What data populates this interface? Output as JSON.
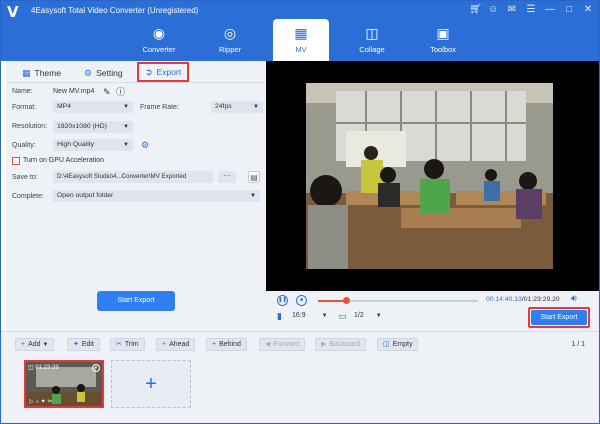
{
  "app": {
    "title": "4Easysoft Total Video Converter (Unregistered)",
    "logo": "V"
  },
  "window_controls": [
    "cart-icon",
    "user-icon",
    "chat-icon",
    "menu-icon",
    "minimize-icon",
    "maximize-icon",
    "close-icon"
  ],
  "nav": [
    {
      "label": "Converter",
      "icon": "converter-icon"
    },
    {
      "label": "Ripper",
      "icon": "ripper-icon"
    },
    {
      "label": "MV",
      "icon": "mv-icon",
      "active": true
    },
    {
      "label": "Collage",
      "icon": "collage-icon"
    },
    {
      "label": "Toolbox",
      "icon": "toolbox-icon"
    }
  ],
  "tabs": {
    "theme": "Theme",
    "setting": "Setting",
    "export": "Export"
  },
  "export": {
    "name_label": "Name:",
    "name_value": "New MV.mp4",
    "format_label": "Format:",
    "format_value": "MP4",
    "frame_rate_label": "Frame Rate:",
    "frame_rate_value": "24fps",
    "resolution_label": "Resolution:",
    "resolution_value": "1920x1080 (HD)",
    "quality_label": "Quality:",
    "quality_value": "High Quality",
    "gpu_label": "Turn on GPU Acceleration",
    "save_to_label": "Save to:",
    "save_to_value": "D:\\4Easysoft Studio\\4...Converter\\MV Exported",
    "dots": "···",
    "complete_label": "Complete:",
    "complete_value": "Open output folder",
    "start_button": "Start Export"
  },
  "player": {
    "current_time": "00:14:40.13",
    "total_time": "/01:23:29.20",
    "progress": 0.18,
    "aspect_ratio": "16:9",
    "page": "1/2",
    "start_button": "Start Export"
  },
  "toolbar": {
    "add": "Add",
    "edit": "Edit",
    "trim": "Trim",
    "ahead": "Ahead",
    "behind": "Behind",
    "forward": "Forward",
    "backward": "Backward",
    "empty": "Empty",
    "page_count": "1 / 1"
  },
  "clip": {
    "duration": "01:23:29"
  },
  "colors": {
    "accent": "#2b6fd6",
    "highlight": "#e53939",
    "button": "#2f7ff0",
    "progress": "#e6533b"
  }
}
